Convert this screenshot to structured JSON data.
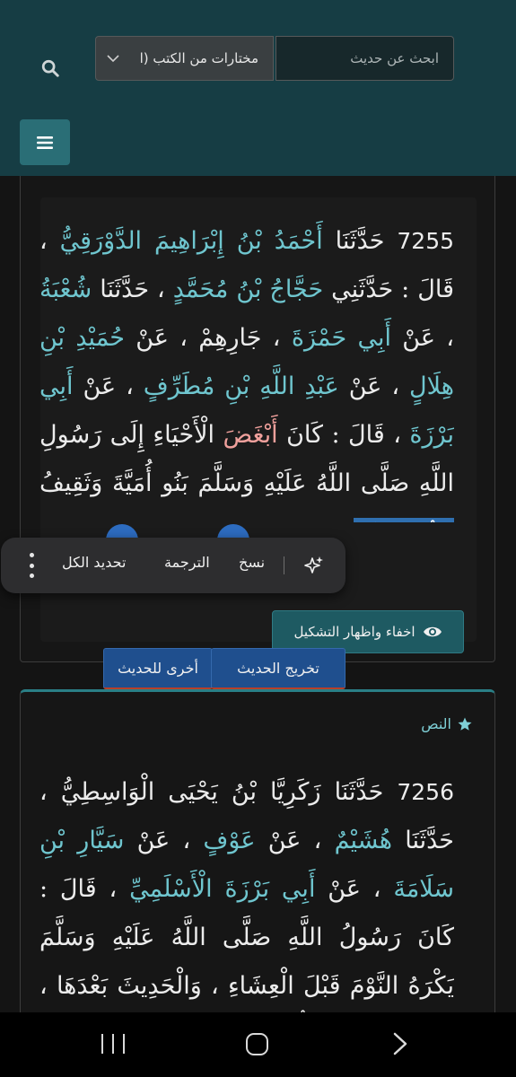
{
  "header": {
    "search_placeholder": "ابحث عن حديث",
    "select_value": "مختارات من الكتب (ا"
  },
  "card1": {
    "hadith_number": "7255",
    "segments": [
      {
        "text": " حَدَّثَنَا ",
        "c": ""
      },
      {
        "text": "أَحْمَدُ بْنُ إِبْرَاهِيمَ الدَّوْرَقِيُّ",
        "c": "nm"
      },
      {
        "text": " ، قَالَ : حَدَّثَنِي ",
        "c": ""
      },
      {
        "text": "حَجَّاجُ بْنُ مُحَمَّدٍ",
        "c": "nm"
      },
      {
        "text": " ، حَدَّثَنَا ",
        "c": ""
      },
      {
        "text": "شُعْبَةُ",
        "c": "nm"
      },
      {
        "text": " ، عَنْ ",
        "c": ""
      },
      {
        "text": "أَبِي حَمْزَةَ",
        "c": "nm"
      },
      {
        "text": " ، جَارِهِمْ ، عَنْ ",
        "c": ""
      },
      {
        "text": "حُمَيْدِ بْنِ هِلَالٍ",
        "c": "nm"
      },
      {
        "text": " ، عَنْ ",
        "c": ""
      },
      {
        "text": "عَبْدِ اللَّهِ بْنِ مُطَرِّفٍ",
        "c": "nm"
      },
      {
        "text": " ، عَنْ ",
        "c": ""
      },
      {
        "text": "أَبِي بَرْزَةَ",
        "c": "nm"
      },
      {
        "text": " ، قَالَ : كَانَ ",
        "c": ""
      },
      {
        "text": "أَبْغَضَ",
        "c": "red"
      },
      {
        "text": " الْأَحْيَاءِ إِلَى رَسُولِ اللَّهِ صَلَّى اللَّهُ عَلَيْهِ وَسَلَّمَ بَنُو أُمَيَّةَ وَثَقِيفُ ",
        "c": ""
      },
      {
        "text": "وَبَنُو حَنِيفَةَ",
        "c": "sel"
      }
    ],
    "toggle_label": "اخفاء واظهار التشكيل"
  },
  "context_menu": {
    "copy": "نسخ",
    "translate": "الترجمة",
    "select_all": "تحديد الكل"
  },
  "tabs": {
    "takhrij": "تخريج الحديث",
    "other": "أخرى للحديث"
  },
  "card2": {
    "label": "النص",
    "hadith_number": "7256",
    "segments": [
      {
        "text": " حَدَّثَنَا زَكَرِيَّا بْنُ يَحْيَى الْوَاسِطِيُّ ، حَدَّثَنَا ",
        "c": ""
      },
      {
        "text": "هُشَيْمٌ",
        "c": "nm"
      },
      {
        "text": " ، عَنْ ",
        "c": ""
      },
      {
        "text": "عَوْفٍ",
        "c": "nm"
      },
      {
        "text": " ، عَنْ ",
        "c": ""
      },
      {
        "text": "سَيَّارِ بْنِ سَلَامَةَ",
        "c": "nm"
      },
      {
        "text": " ، عَنْ ",
        "c": ""
      },
      {
        "text": "أَبِي بَرْزَةَ الْأَسْلَمِيِّ",
        "c": "nm"
      },
      {
        "text": " ، قَالَ : كَانَ رَسُولُ اللَّهِ صَلَّى اللَّهُ عَلَيْهِ وَسَلَّمَ يَكْرَهُ النَّوْمَ قَبْلَ الْعِشَاءِ ، وَالْحَدِيثَ بَعْدَهَا ، قَالَ : وَكَانَ يَقْرَأُ فِي صَلَاةِ",
        "c": ""
      }
    ]
  },
  "colors": {
    "header_bg": "#163d44",
    "accent_teal": "#2a6e76",
    "name_color": "#6fc6cf",
    "highlight_red": "#f0a09c",
    "tab_blue": "#1f4f8e"
  }
}
